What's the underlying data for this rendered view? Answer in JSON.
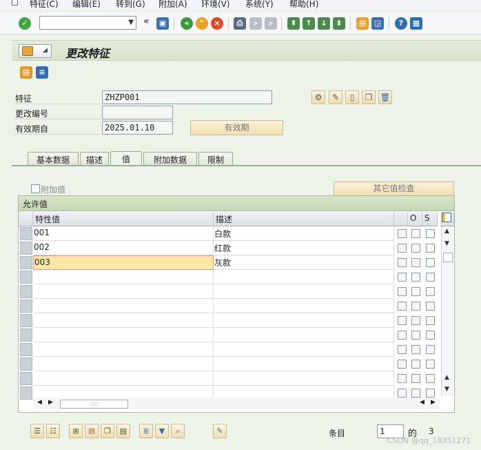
{
  "menu": {
    "items": [
      "特征(C)",
      "编辑(E)",
      "转到(G)",
      "附加(A)",
      "环境(V)",
      "系统(Y)",
      "帮助(H)"
    ]
  },
  "toolbar": {
    "command_field": "",
    "collapse_symbol": "«"
  },
  "title": "更改特征",
  "form": {
    "characteristic_label": "特征",
    "characteristic_value": "ZHZP001",
    "change_number_label": "更改编号",
    "change_number_value": "",
    "valid_from_label": "有效期自",
    "valid_from_value": "2025.01.10",
    "validity_button": "有效期"
  },
  "tabs": [
    "基本数据",
    "描述",
    "值",
    "附加数据",
    "限制"
  ],
  "active_tab": "值",
  "values_tab": {
    "additional_values_label": "附加值",
    "other_value_check_button": "其它值检查",
    "panel_title": "允许值",
    "columns": {
      "value": "特性值",
      "description": "描述",
      "o": "O",
      "s": "S"
    },
    "rows": [
      {
        "value": "001",
        "description": "白款"
      },
      {
        "value": "002",
        "description": "红款"
      },
      {
        "value": "003",
        "description": "灰款"
      }
    ]
  },
  "footer": {
    "entry_label": "条目",
    "entry_value": "1",
    "of_label": "的",
    "total": "3"
  },
  "watermark": "CSDN @qq_18351271"
}
